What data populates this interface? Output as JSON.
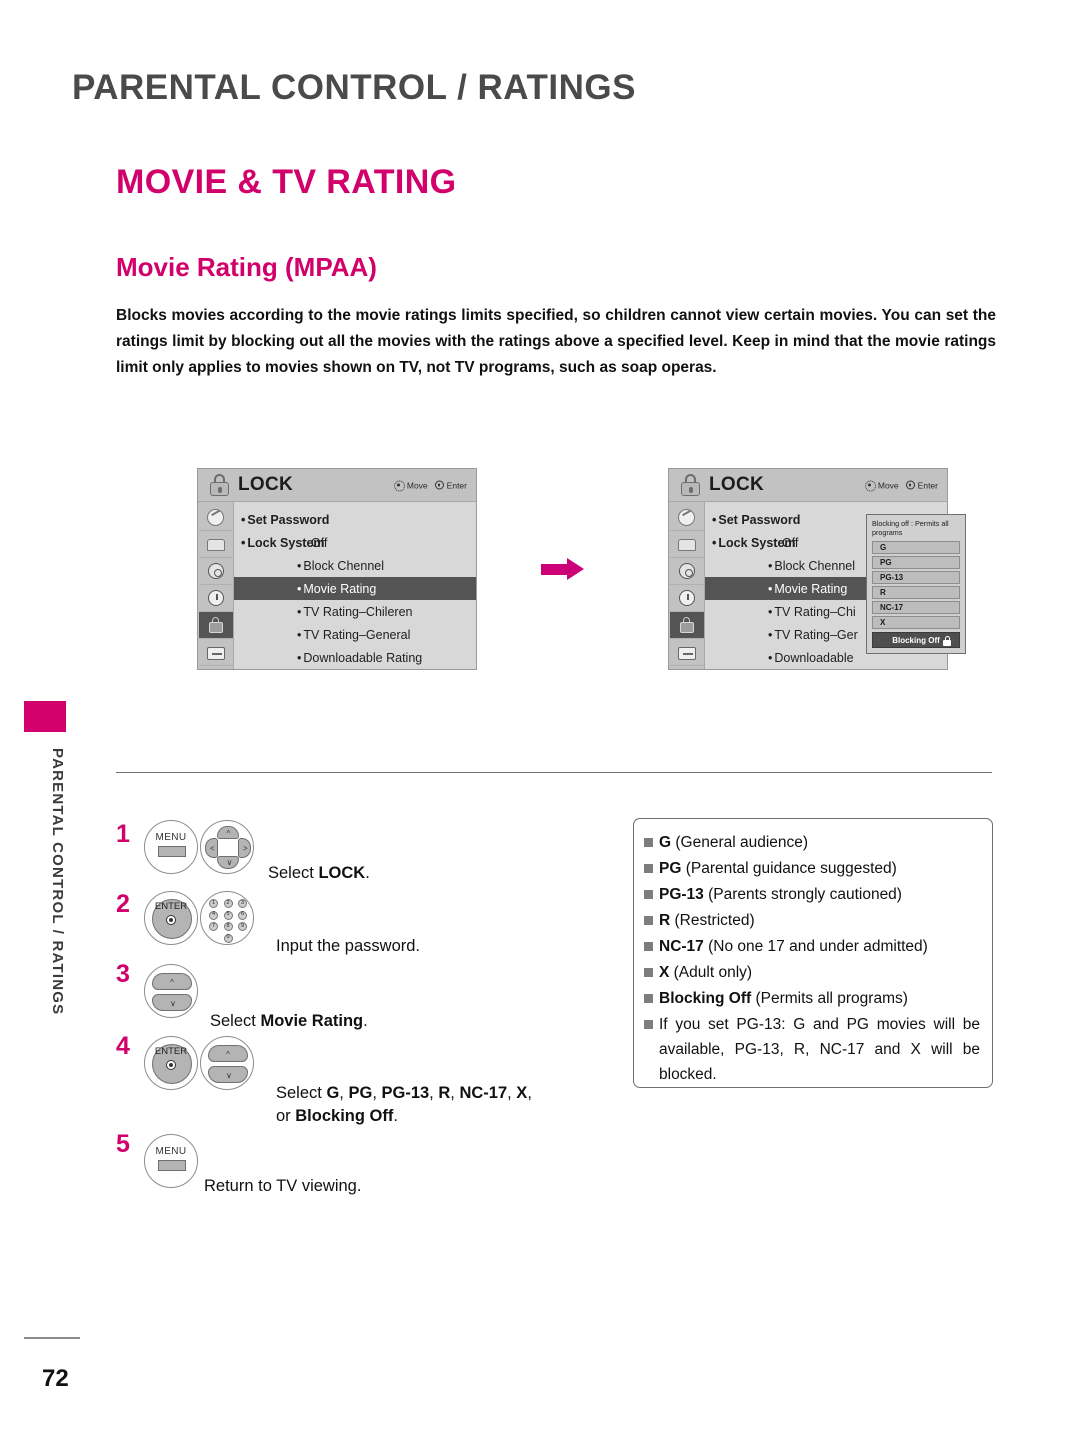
{
  "header": {
    "chapter_title": "PARENTAL CONTROL / RATINGS",
    "section_title": "MOVIE & TV RATING",
    "subsection_title": "Movie Rating (MPAA)",
    "intro_paragraph": "Blocks movies according to the movie ratings limits specified, so children cannot view certain movies. You can set the ratings limit by blocking out all the movies with the ratings above a specified level. Keep in mind that the movie ratings limit only applies to movies shown on TV, not TV programs, such as soap operas."
  },
  "side_tab": {
    "vertical_label": "PARENTAL CONTROL / RATINGS"
  },
  "osd": {
    "title": "LOCK",
    "hint_move": "Move",
    "hint_enter": "Enter",
    "rail_icons": [
      "picture-icon",
      "screen-icon",
      "gear-icon",
      "clock-icon",
      "lock-icon",
      "input-icon"
    ],
    "menu": [
      {
        "label": "Set Password",
        "value": "",
        "indent": false,
        "selected": false
      },
      {
        "label": "Lock System",
        "value": ": Off",
        "indent": false,
        "selected": false
      },
      {
        "label": "Block Chennel",
        "value": "",
        "indent": true,
        "selected": false
      },
      {
        "label": "Movie Rating",
        "value": "",
        "indent": true,
        "selected": true
      },
      {
        "label": "TV Rating–Chileren",
        "value": "",
        "indent": true,
        "selected": false
      },
      {
        "label": "TV Rating–General",
        "value": "",
        "indent": true,
        "selected": false
      },
      {
        "label": "Downloadable Rating",
        "value": "",
        "indent": true,
        "selected": false
      }
    ],
    "menu_truncated": [
      {
        "label": "Set Password",
        "value": "",
        "indent": false,
        "selected": false
      },
      {
        "label": "Lock System",
        "value": ": Off",
        "indent": false,
        "selected": false
      },
      {
        "label": "Block Chennel",
        "value": "",
        "indent": true,
        "selected": false
      },
      {
        "label": "Movie Rating",
        "value": "",
        "indent": true,
        "selected": true
      },
      {
        "label": "TV Rating–Chi",
        "value": "",
        "indent": true,
        "selected": false
      },
      {
        "label": "TV Rating–Ger",
        "value": "",
        "indent": true,
        "selected": false
      },
      {
        "label": "Downloadable",
        "value": "",
        "indent": true,
        "selected": false
      }
    ],
    "popup": {
      "header": "Blocking off : Permits all programs",
      "options": [
        "G",
        "PG",
        "PG-13",
        "R",
        "NC-17",
        "X"
      ],
      "selected_option": "Blocking Off"
    }
  },
  "steps": [
    {
      "number": "1",
      "buttons": [
        "menu-button",
        "four-way-navigation-button"
      ],
      "menu_label": "MENU",
      "text_html": "Select <b>LOCK</b>."
    },
    {
      "number": "2",
      "buttons": [
        "enter-button",
        "number-pad-button"
      ],
      "enter_label": "ENTER",
      "text_html": "Input the password."
    },
    {
      "number": "3",
      "buttons": [
        "up-down-navigation-button"
      ],
      "text_html": "Select <b>Movie Rating</b>."
    },
    {
      "number": "4",
      "buttons": [
        "enter-button",
        "up-down-navigation-button"
      ],
      "enter_label": "ENTER",
      "text_html": "Select <b>G</b>, <b>PG</b>, <b>PG-13</b>, <b>R</b>, <b>NC-17</b>, <b>X</b>,<br>or <b>Blocking Off</b>."
    },
    {
      "number": "5",
      "buttons": [
        "menu-button"
      ],
      "menu_label": "MENU",
      "text_html": "Return to TV viewing."
    }
  ],
  "numpad_keys": [
    "1",
    "2",
    "3",
    "4",
    "5",
    "6",
    "7",
    "8",
    "9",
    "0"
  ],
  "note_box": {
    "lines": [
      "<b>G</b> (General audience)",
      "<b>PG</b> (Parental guidance suggested)",
      "<b>PG-13</b> (Parents strongly cautioned)",
      "<b>R</b> (Restricted)",
      "<b>NC-17</b> (No one 17 and under admitted)",
      "<b>X</b> (Adult only)",
      "<b>Blocking Off</b> (Permits all programs)",
      "If you set PG-13: G and PG movies will be available, PG-13, R, NC-17 and X will be blocked."
    ]
  },
  "footer": {
    "page_number": "72"
  },
  "colors": {
    "accent_pink": "#d1006b",
    "title_gray": "#4a4a4a",
    "osd_bg": "#d8d8d8",
    "osd_selected": "#545454"
  }
}
